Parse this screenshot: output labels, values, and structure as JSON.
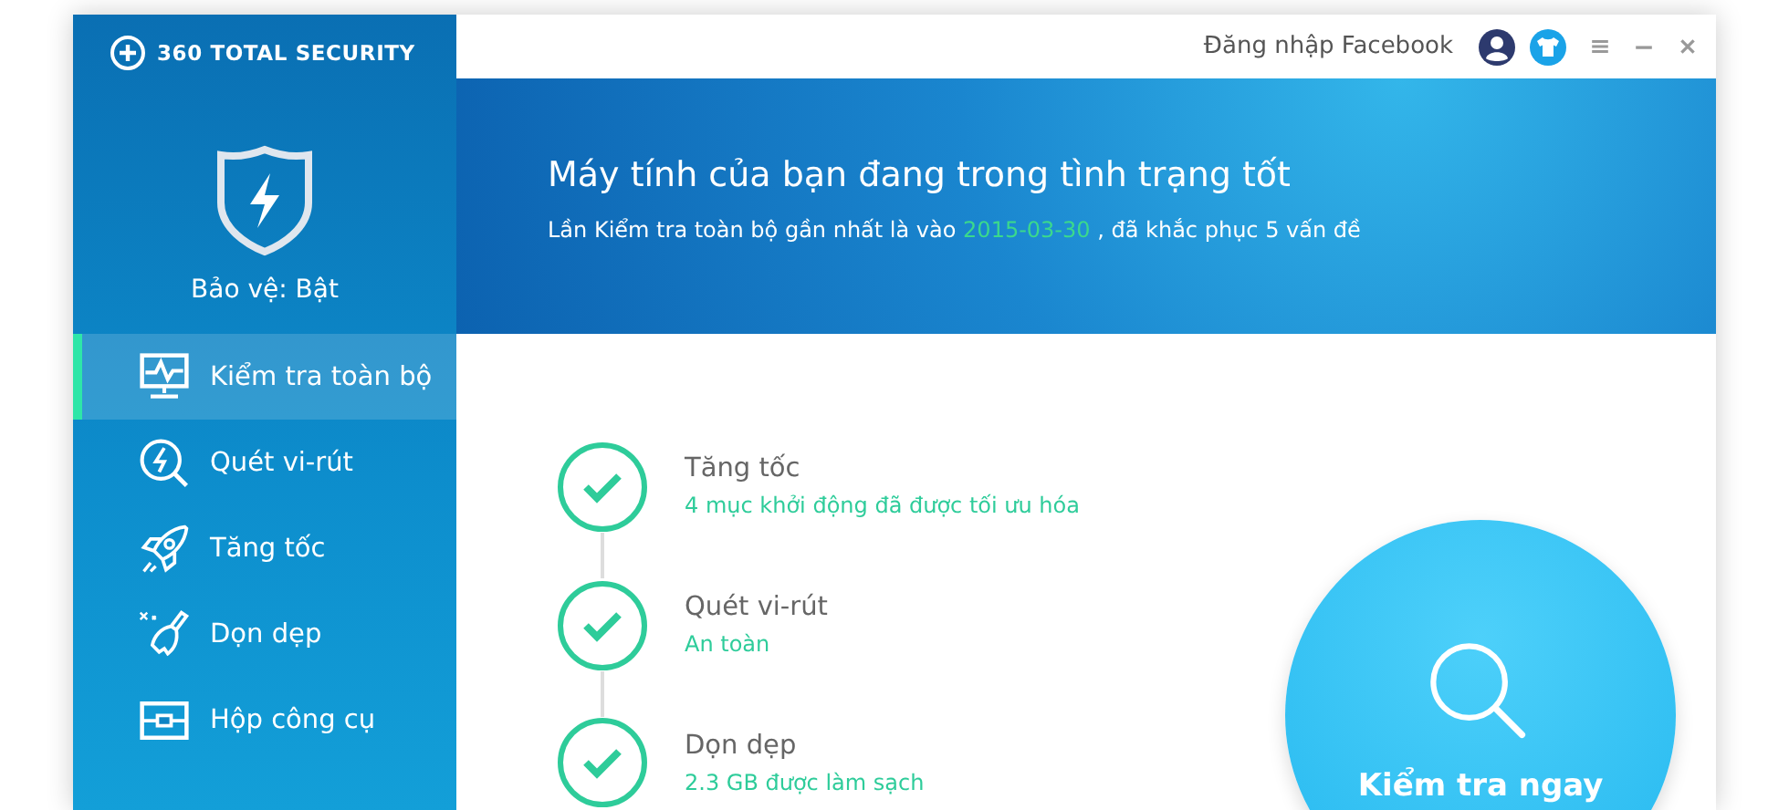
{
  "app": {
    "logo": "360 TOTAL SECURITY"
  },
  "protection": {
    "label": "Bảo vệ: Bật",
    "on": true
  },
  "sidebar": {
    "items": [
      {
        "kind": "monitor",
        "label": "Kiểm tra toàn bộ",
        "selected": true
      },
      {
        "kind": "scan",
        "label": "Quét vi-rút",
        "selected": false
      },
      {
        "kind": "rocket",
        "label": "Tăng tốc",
        "selected": false
      },
      {
        "kind": "broom",
        "label": "Dọn dẹp",
        "selected": false
      },
      {
        "kind": "toolbox",
        "label": "Hộp công cụ",
        "selected": false
      }
    ]
  },
  "topbar": {
    "login": "Đăng nhập Facebook"
  },
  "banner": {
    "title": "Máy tính của bạn đang trong tình trạng tốt",
    "summary_before": "Lần Kiểm tra toàn bộ gần nhất là vào",
    "date": "2015-03-30",
    "summary_after": ", đã khắc phục 5 vấn đề"
  },
  "checks": [
    {
      "title": "Tăng tốc",
      "detail": "4 mục khởi động đã được tối ưu hóa",
      "done": true
    },
    {
      "title": "Quét vi-rút",
      "detail": "An toàn",
      "done": true
    },
    {
      "title": "Dọn dẹp",
      "detail": "2.3 GB được làm sạch",
      "done": true
    }
  ],
  "action": {
    "label": "Kiểm tra ngay"
  }
}
